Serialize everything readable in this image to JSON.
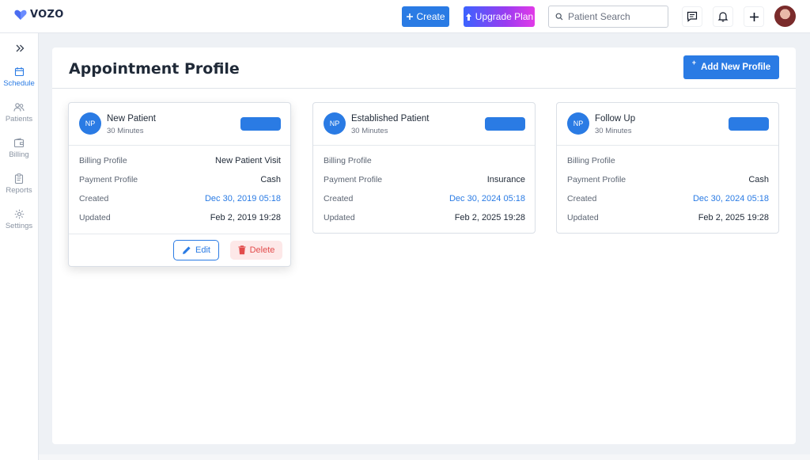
{
  "app": {
    "logo_text": "VOZO"
  },
  "topbar": {
    "create_label": "Create",
    "upgrade_label": "Upgrade Plan",
    "search_placeholder": "Patient Search",
    "icons": [
      "message-icon",
      "bell-icon",
      "plus-icon"
    ]
  },
  "sidebar": {
    "items": [
      {
        "label": "Schedule",
        "icon": "calendar-icon",
        "active": true
      },
      {
        "label": "Patients",
        "icon": "users-icon",
        "active": false
      },
      {
        "label": "Billing",
        "icon": "wallet-icon",
        "active": false
      },
      {
        "label": "Reports",
        "icon": "clipboard-icon",
        "active": false
      },
      {
        "label": "Settings",
        "icon": "gear-icon",
        "active": false
      }
    ]
  },
  "page": {
    "title": "Appointment Profile",
    "add_button_label": "Add New Profile"
  },
  "field_labels": {
    "billing": "Billing Profile",
    "payment": "Payment Profile",
    "created": "Created",
    "updated": "Updated"
  },
  "cards": [
    {
      "initials": "NP",
      "name": "New Patient",
      "duration": "30 Minutes",
      "color": "#2a7be4",
      "billing_profile": "New Patient Visit",
      "payment_profile": "Cash",
      "created": "Dec 30, 2019 05:18",
      "updated": "Feb 2, 2019 19:28",
      "edit_label": "Edit",
      "delete_label": "Delete"
    },
    {
      "initials": "NP",
      "name": "Established Patient",
      "duration": "30 Minutes",
      "color": "#2a7be4",
      "billing_profile": "",
      "payment_profile": "Insurance",
      "created": "Dec 30, 2024 05:18",
      "updated": "Feb 2, 2025 19:28"
    },
    {
      "initials": "NP",
      "name": "Follow Up",
      "duration": "30 Minutes",
      "color": "#2a7be4",
      "billing_profile": "",
      "payment_profile": "Cash",
      "created": "Dec 30, 2024 05:18",
      "updated": "Feb 2, 2025 19:28"
    }
  ],
  "colors": {
    "accent": "#2a7be4",
    "danger": "#e24b4b"
  }
}
